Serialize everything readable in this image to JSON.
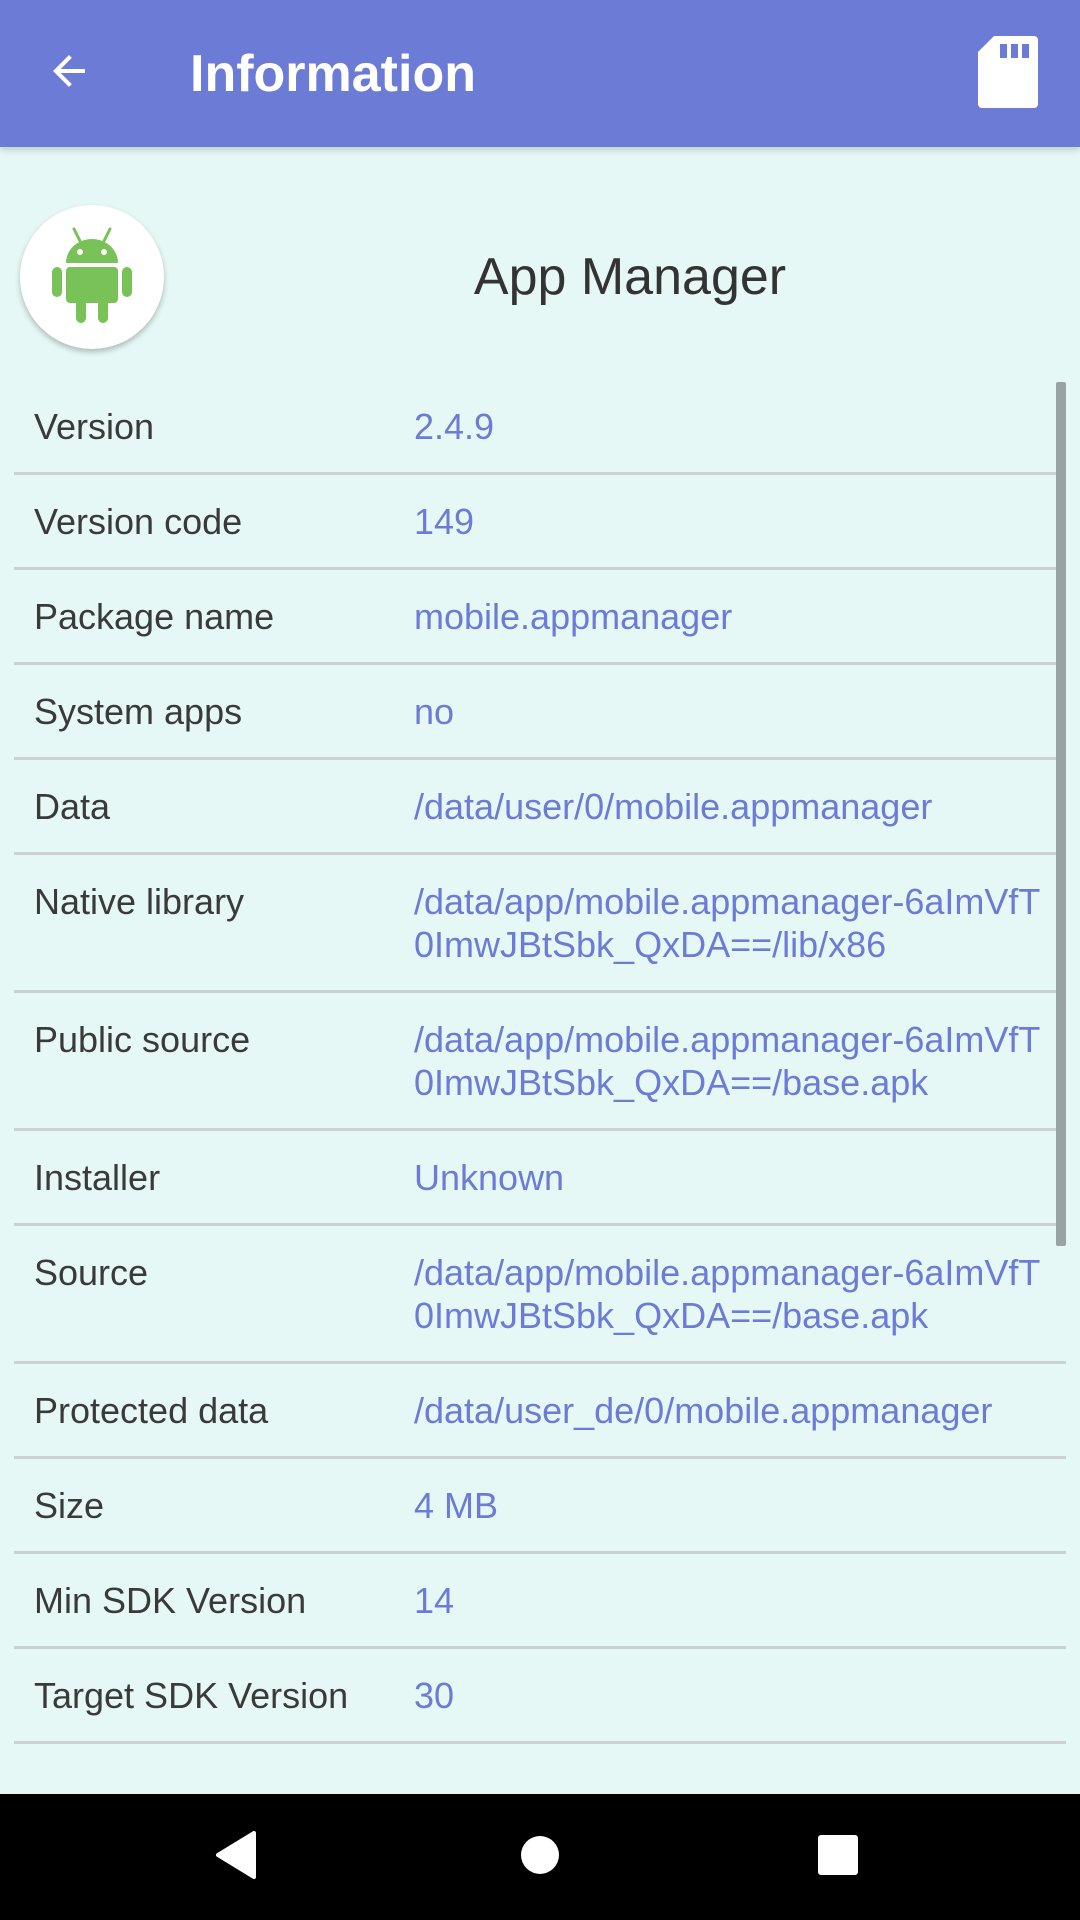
{
  "appbar": {
    "title": "Information",
    "back_icon": "arrow-back-icon",
    "sd_icon": "sd-card-icon",
    "color": "#6C7BD5"
  },
  "app": {
    "name": "App Manager",
    "icon": "android-icon"
  },
  "info": [
    {
      "label": "Version",
      "value": "2.4.9"
    },
    {
      "label": "Version code",
      "value": "149"
    },
    {
      "label": "Package name",
      "value": "mobile.appmanager"
    },
    {
      "label": "System apps",
      "value": "no"
    },
    {
      "label": "Data",
      "value": "/data/user/0/mobile.appmanager"
    },
    {
      "label": "Native library",
      "value": "/data/app/mobile.appmanager-6aImVfT0ImwJBtSbk_QxDA==/lib/x86"
    },
    {
      "label": "Public source",
      "value": "/data/app/mobile.appmanager-6aImVfT0ImwJBtSbk_QxDA==/base.apk"
    },
    {
      "label": "Installer",
      "value": "Unknown"
    },
    {
      "label": "Source",
      "value": "/data/app/mobile.appmanager-6aImVfT0ImwJBtSbk_QxDA==/base.apk"
    },
    {
      "label": "Protected data",
      "value": "/data/user_de/0/mobile.appmanager"
    },
    {
      "label": "Size",
      "value": "4 MB"
    },
    {
      "label": "Min SDK Version",
      "value": "14"
    },
    {
      "label": "Target SDK Version",
      "value": "30"
    }
  ],
  "navbar": {
    "back_icon": "nav-back-icon",
    "home_icon": "nav-home-icon",
    "recents_icon": "nav-recents-icon"
  },
  "colors": {
    "background": "#E6F8F5",
    "value_text": "#6C7BD5",
    "android_green": "#78C257"
  }
}
